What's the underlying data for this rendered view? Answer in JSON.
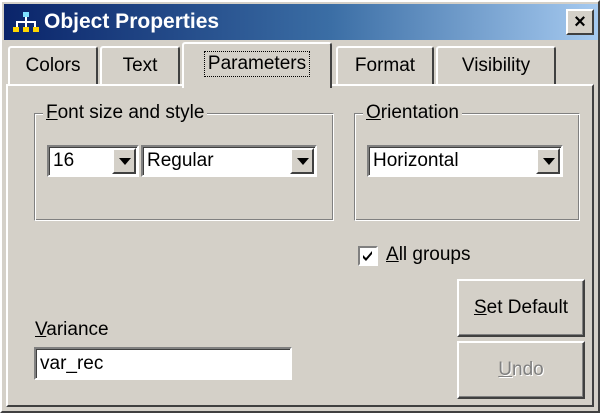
{
  "window": {
    "title": "Object Properties",
    "close_glyph": "×",
    "icon": "hierarchy-icon"
  },
  "tabs": [
    {
      "label": "Colors",
      "active": false
    },
    {
      "label": "Text",
      "active": false
    },
    {
      "label": "Parameters",
      "active": true
    },
    {
      "label": "Format",
      "active": false
    },
    {
      "label": "Visibility",
      "active": false
    }
  ],
  "font_group": {
    "label_access": "F",
    "label_rest": "ont size and style",
    "size_value": "16",
    "style_value": "Regular"
  },
  "orientation_group": {
    "label_access": "O",
    "label_rest": "rientation",
    "value": "Horizontal"
  },
  "all_groups": {
    "label_access": "A",
    "label_rest": "ll groups",
    "checked": true
  },
  "variance": {
    "label_access": "V",
    "label_rest": "ariance",
    "value": "var_rec"
  },
  "buttons": {
    "set_default_access": "S",
    "set_default_rest": "et Default",
    "undo_access": "U",
    "undo_rest": "ndo",
    "undo_enabled": false
  },
  "colors": {
    "face": "#d4d0c8",
    "title_start": "#0a246a",
    "title_end": "#a6caf0",
    "disabled_text": "#808080"
  }
}
